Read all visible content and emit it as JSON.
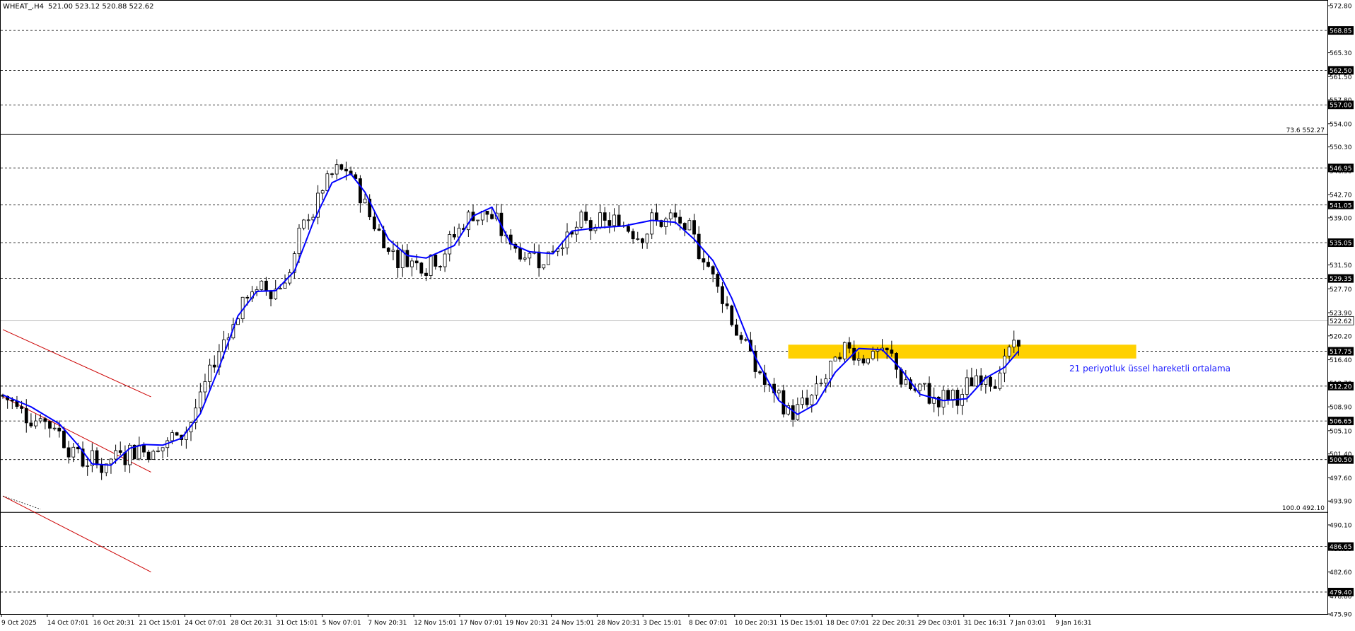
{
  "header": {
    "symbol_timeframe": "WHEAT_,H4",
    "ohlc": "521.00 523.12 520.88 522.62"
  },
  "colors": {
    "background": "#ffffff",
    "candle": "#000000",
    "ema": "#0000ff",
    "zone": "#ffd100",
    "channel": "#cc0000",
    "grid_dash": "#000000",
    "annotation": "#1a1aff"
  },
  "chart_data": {
    "type": "candlestick",
    "title": "",
    "symbol": "WHEAT_",
    "timeframe": "H4",
    "ylim": [
      475.9,
      572.8
    ],
    "y_ticks": [
      "572.80",
      "569.10",
      "565.30",
      "561.50",
      "557.80",
      "554.00",
      "550.30",
      "546.50",
      "542.70",
      "539.00",
      "535.20",
      "531.50",
      "527.70",
      "523.90",
      "520.20",
      "516.40",
      "512.70",
      "508.90",
      "505.10",
      "501.40",
      "497.60",
      "493.90",
      "490.10",
      "486.30",
      "482.60",
      "478.80",
      "475.90"
    ],
    "x_ticks": [
      "9 Oct 2025",
      "14 Oct 07:01",
      "16 Oct 20:31",
      "21 Oct 15:01",
      "24 Oct 07:01",
      "28 Oct 20:31",
      "31 Oct 15:01",
      "5 Nov 07:01",
      "7 Nov 20:31",
      "12 Nov 15:01",
      "17 Nov 07:01",
      "19 Nov 20:31",
      "24 Nov 15:01",
      "28 Nov 20:31",
      "3 Dec 15:01",
      "8 Dec 07:01",
      "10 Dec 20:31",
      "15 Dec 15:01",
      "18 Dec 07:01",
      "22 Dec 20:31",
      "29 Dec 03:01",
      "31 Dec 16:31",
      "7 Jan 03:01",
      "9 Jan 16:31"
    ],
    "price_levels": [
      "568.85",
      "562.50",
      "557.00",
      "546.95",
      "541.05",
      "535.05",
      "529.35",
      "517.75",
      "512.20",
      "506.65",
      "500.50",
      "486.65",
      "479.40"
    ],
    "current_price": "522.62",
    "fib_levels": [
      {
        "label": "73.6 552.27",
        "value": 552.27
      },
      {
        "label": "100.0 492.10",
        "value": 492.1
      }
    ],
    "support_zone": {
      "low": 516.6,
      "high": 518.8
    },
    "annotation": "21 periyotluk üssel hareketli ortalama",
    "ema_path": [
      [
        0,
        510.8
      ],
      [
        6,
        508.9
      ],
      [
        12,
        506.2
      ],
      [
        16,
        502.8
      ],
      [
        19,
        499.8
      ],
      [
        23,
        499.6
      ],
      [
        27,
        502.3
      ],
      [
        30,
        502.9
      ],
      [
        34,
        502.8
      ],
      [
        38,
        503.9
      ],
      [
        42,
        507.8
      ],
      [
        46,
        515.2
      ],
      [
        50,
        523.4
      ],
      [
        54,
        527.3
      ],
      [
        58,
        527.4
      ],
      [
        62,
        530.5
      ],
      [
        66,
        538.3
      ],
      [
        70,
        544.6
      ],
      [
        74,
        546.0
      ],
      [
        77,
        543.1
      ],
      [
        82,
        535.6
      ],
      [
        86,
        533.0
      ],
      [
        90,
        532.6
      ],
      [
        96,
        534.6
      ],
      [
        100,
        539.3
      ],
      [
        104,
        540.7
      ],
      [
        108,
        534.9
      ],
      [
        112,
        533.6
      ],
      [
        117,
        533.3
      ],
      [
        121,
        536.9
      ],
      [
        126,
        537.4
      ],
      [
        132,
        537.7
      ],
      [
        138,
        538.6
      ],
      [
        143,
        538.3
      ],
      [
        147,
        535.6
      ],
      [
        151,
        532.2
      ],
      [
        155,
        526.2
      ],
      [
        160,
        516.8
      ],
      [
        165,
        509.9
      ],
      [
        169,
        507.7
      ],
      [
        173,
        509.4
      ],
      [
        177,
        514.4
      ],
      [
        182,
        518.2
      ],
      [
        187,
        518.0
      ],
      [
        191,
        514.9
      ],
      [
        195,
        510.9
      ],
      [
        200,
        509.9
      ],
      [
        205,
        510.2
      ],
      [
        209,
        513.5
      ],
      [
        213,
        515.2
      ],
      [
        216,
        517.8
      ]
    ],
    "channel_lines": [
      [
        [
          0,
          521.2
        ],
        [
          33,
          510.5
        ]
      ],
      [
        [
          0,
          510.5
        ],
        [
          33,
          498.5
        ]
      ],
      [
        [
          0,
          494.7
        ],
        [
          33,
          482.6
        ]
      ]
    ]
  }
}
